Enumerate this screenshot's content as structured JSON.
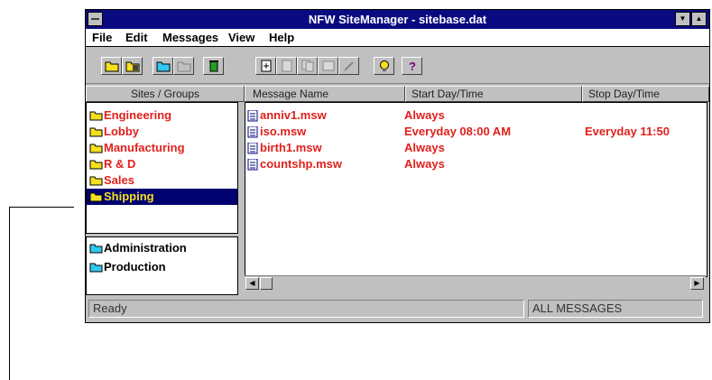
{
  "window": {
    "title": "NFW SiteManager - sitebase.dat"
  },
  "menu": [
    "File",
    "Edit",
    "Messages",
    "View",
    "Help"
  ],
  "toolbar": {
    "tools": [
      "open-folder",
      "save-folder",
      "new-group",
      "group-properties",
      "delete",
      "import",
      "export",
      "copy",
      "properties",
      "edit",
      "light-bulb",
      "help"
    ]
  },
  "sites_panel": {
    "header": "Sites / Groups",
    "groups": [
      "Engineering",
      "Lobby",
      "Manufacturing",
      "R & D",
      "Sales",
      "Shipping"
    ],
    "selected": "Shipping",
    "sites": [
      "Administration",
      "Production"
    ]
  },
  "messages_panel": {
    "columns": [
      "Message Name",
      "Start Day/Time",
      "Stop Day/Time"
    ],
    "rows": [
      {
        "name": "anniv1.msw",
        "start": "Always",
        "stop": ""
      },
      {
        "name": "iso.msw",
        "start": "Everyday 08:00 AM",
        "stop": "Everyday 11:50"
      },
      {
        "name": "birth1.msw",
        "start": "Always",
        "stop": ""
      },
      {
        "name": "countshp.msw",
        "start": "Always",
        "stop": ""
      }
    ]
  },
  "status": {
    "left": "Ready",
    "right": "ALL MESSAGES"
  },
  "colors": {
    "titlebar": "#0a0a80",
    "message_text": "#e0201c",
    "selection": "#000070",
    "folder": "#f5e020",
    "site_folder": "#30c8f0"
  }
}
